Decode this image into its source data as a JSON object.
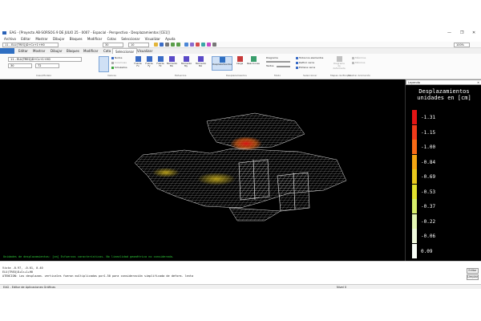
{
  "window": {
    "title": "EAG - [Proyecto AB-SORSOG 9 DE JULIO 25 - 0007 - Espacial - Perspectiva - Desplazamientos [CE1]]",
    "minimize": "—",
    "maximize": "❐",
    "close": "✕"
  },
  "menubar": [
    "Archivo",
    "Editar",
    "Mostrar",
    "Dibujar",
    "Bloques",
    "Modificar",
    "Cotas",
    "Seleccionar",
    "Visualizar",
    "Ayuda"
  ],
  "quickbar": {
    "combo1": "11 - ELU(TREQ)D+Cc+1+H0",
    "combo2": "30",
    "combo3": "10",
    "zoom": "100%"
  },
  "tabs": [
    "",
    "Editar",
    "Mostrar",
    "Dibujar",
    "Bloques",
    "Modificar",
    "Cota",
    "Seleccionar",
    "Visualizar"
  ],
  "ribbon": {
    "combo_left": "11 - ELU(TREQ)D+Cc+1+H0",
    "combo_left2": "30",
    "combo_left3": "72",
    "group_caso": "Caso/Modelo",
    "groups": [
      "Valores",
      "Esfuerzos",
      "Desplazamientos",
      "Modo",
      "Seleccionar",
      "Mapas de Bloque",
      "Mostrar Animación"
    ],
    "buttons": [
      "Fuerza Fx",
      "Fuerza Fy",
      "Fuerza Fz",
      "Momento Mx",
      "Momento My",
      "Momento Mz",
      "Desplazamientos",
      "Carga",
      "Reacciones"
    ],
    "check_items": [
      "Nodos",
      "Columnas",
      "Simulados"
    ],
    "diagram_labels": [
      "Diagrama",
      "Textos"
    ],
    "select_items": [
      "Todos los elementos",
      "Definir cerca",
      "Elimina cerca"
    ],
    "anim_items": [
      "Máximos",
      "Mínimos"
    ],
    "deform_label": "Diagrama de deformada"
  },
  "legend": {
    "header": "Leyenda",
    "close": "✕",
    "title_line1": "Desplazamientos",
    "title_line2": "unidades en [cm]",
    "items": [
      {
        "value": "-1.31",
        "color": "#e31414"
      },
      {
        "value": "-1.15",
        "color": "#ef3a1a"
      },
      {
        "value": "-1.00",
        "color": "#f86a16"
      },
      {
        "value": "-0.84",
        "color": "#f3a512"
      },
      {
        "value": "-0.69",
        "color": "#e8c81c"
      },
      {
        "value": "-0.53",
        "color": "#e2e22e"
      },
      {
        "value": "-0.37",
        "color": "#d7ee6a"
      },
      {
        "value": "-0.22",
        "color": "#e4f6b4"
      },
      {
        "value": "-0.06",
        "color": "#eef8dc"
      },
      {
        "value": "0.09",
        "color": "#f8fdf6"
      }
    ]
  },
  "viewport_message": "Unidades de desplazamientos: [cm] Esfuerzos característicos. No linealidad geométrica no considerada.",
  "console": {
    "line1": "Vista      -0.97,   -0.01,   0.40",
    "line2": "ELU(TREQ)D+Cc+1+H0",
    "line3": "ATENCIÓN: Los desplazam. verticales fueron multiplicados por1.50 para consideración simplificada de deform. lenta"
  },
  "side_buttons": [
    "Editar",
    "Limpiar"
  ],
  "status": {
    "left": "EAG - Editor de Aplicaciones Gráficas",
    "mid": "Nivel 0"
  },
  "colors": {
    "accent": "#2f6fc2",
    "viewport_bg": "#000000",
    "mesh": "#d9d9d9",
    "msg_green": "#2fcf3a"
  }
}
